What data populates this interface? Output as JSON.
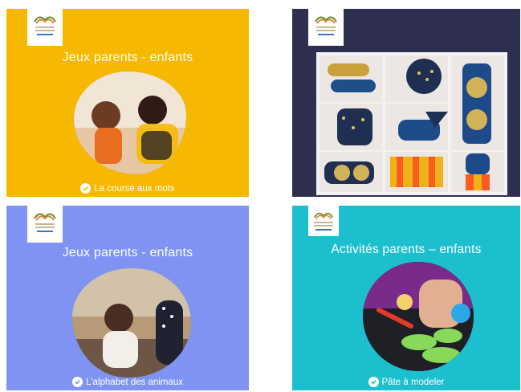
{
  "colors": {
    "card1": "#f6b800",
    "card2": "#2e2f4f",
    "card3": "#7f93f2",
    "card4": "#1cbfce"
  },
  "cards": [
    {
      "title": "Jeux parents - enfants",
      "caption": "La course aux mots",
      "image": "parent-child-photo"
    },
    {
      "title": "",
      "caption": "",
      "image": "paper-rocket-collage"
    },
    {
      "title": "Jeux parents - enfants",
      "caption": "L'alphabet des animaux",
      "image": "child-playing-photo"
    },
    {
      "title": "Activités parents – enfants",
      "caption": "Pâte à modeler",
      "image": "play-dough-photo"
    }
  ],
  "icons": {
    "logo": "book-logo-icon",
    "check": "check-circle-icon"
  }
}
